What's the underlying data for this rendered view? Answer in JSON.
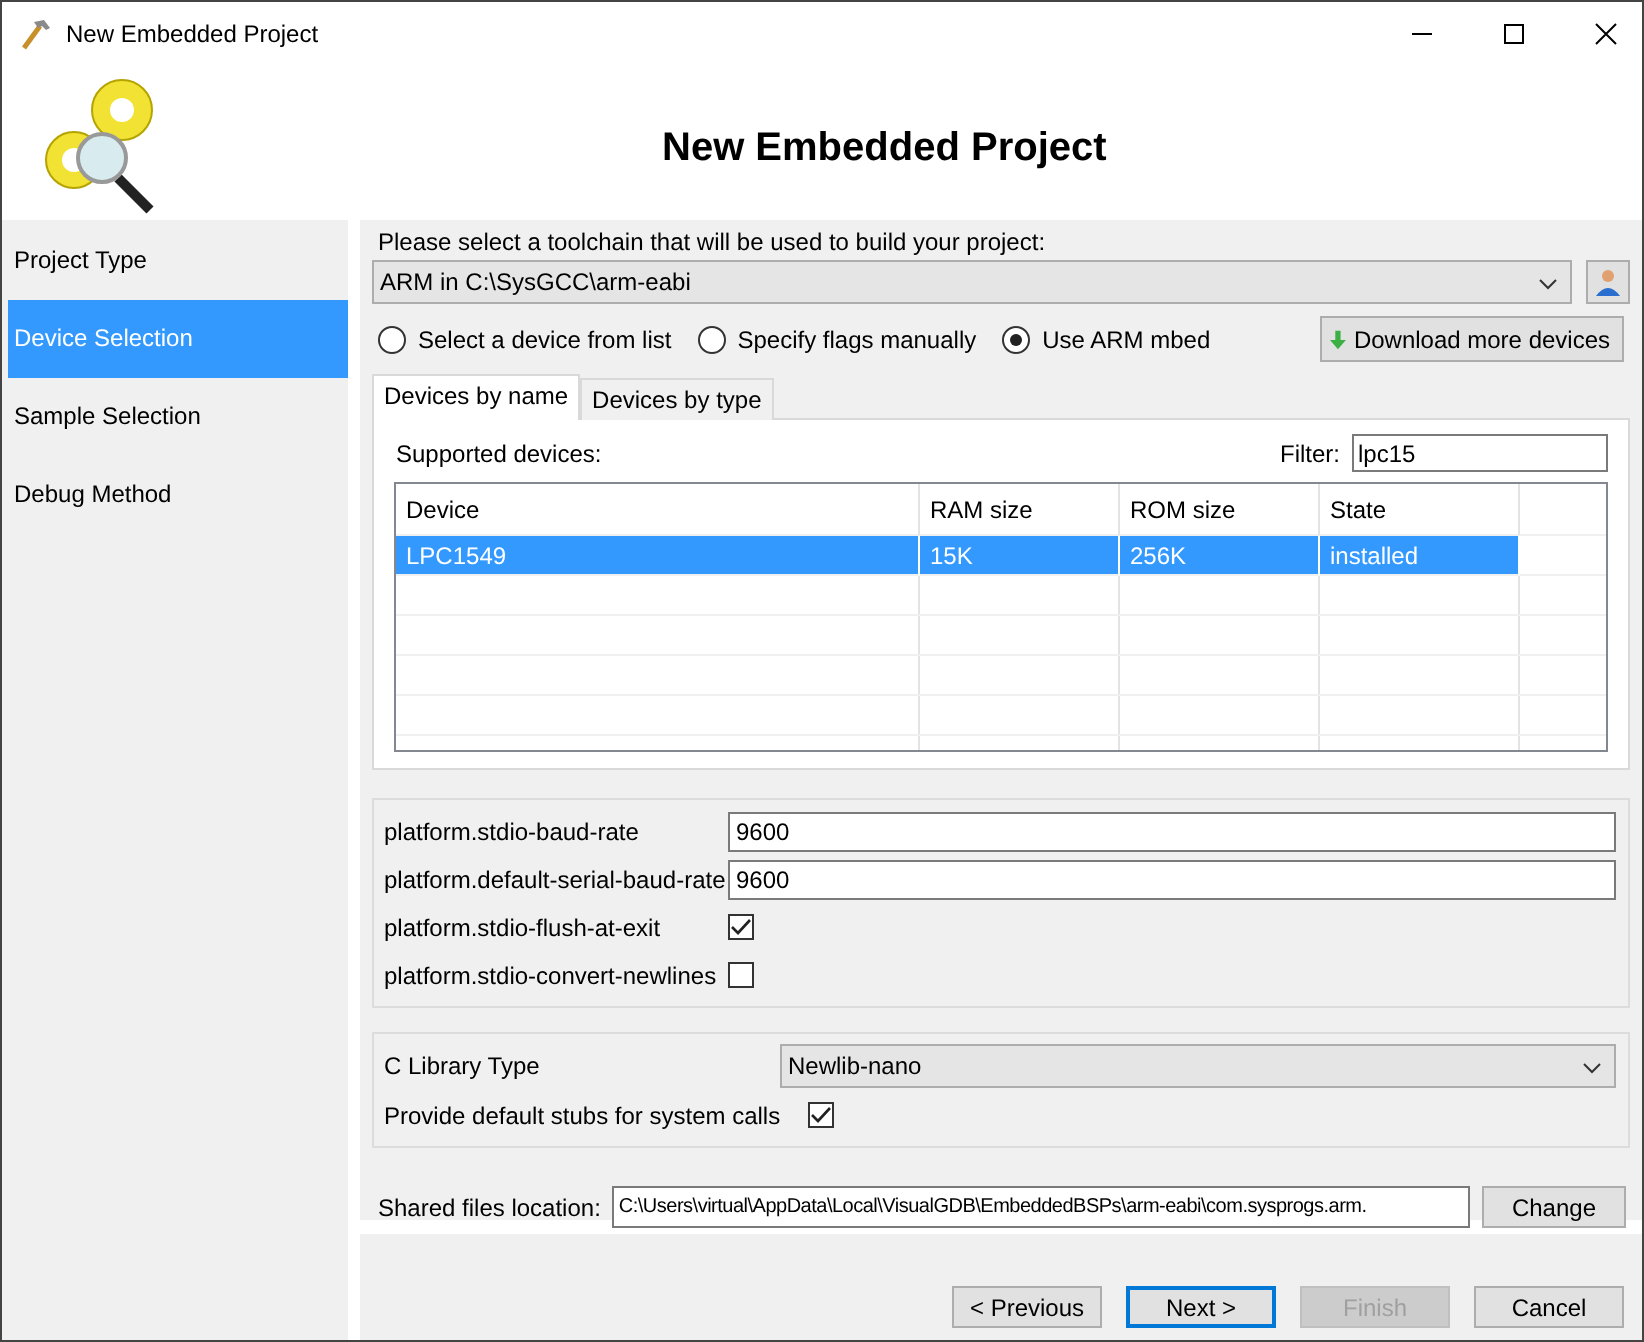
{
  "window": {
    "title": "New Embedded Project"
  },
  "header": {
    "title": "New Embedded Project"
  },
  "sidebar": {
    "items": [
      {
        "label": "Project Type",
        "selected": false
      },
      {
        "label": "Device Selection",
        "selected": true
      },
      {
        "label": "Sample Selection",
        "selected": false
      },
      {
        "label": "Debug Method",
        "selected": false
      }
    ]
  },
  "toolchain": {
    "prompt": "Please select a toolchain that will be used to build your project:",
    "value": "ARM in C:\\SysGCC\\arm-eabi"
  },
  "modes": [
    {
      "label": "Select a device from list",
      "selected": false
    },
    {
      "label": "Specify flags manually",
      "selected": false
    },
    {
      "label": "Use ARM mbed",
      "selected": true
    }
  ],
  "download_button": "Download more devices",
  "tabs": [
    {
      "label": "Devices by name",
      "selected": true
    },
    {
      "label": "Devices by type",
      "selected": false
    }
  ],
  "devices": {
    "label": "Supported devices:",
    "filter_label": "Filter:",
    "filter": "lpc15",
    "columns": [
      "Device",
      "RAM size",
      "ROM size",
      "State"
    ],
    "rows": [
      {
        "cells": [
          "LPC1549",
          "15K",
          "256K",
          "installed"
        ],
        "selected": true
      }
    ]
  },
  "settings": [
    {
      "kind": "text",
      "label": "platform.stdio-baud-rate",
      "value": "9600"
    },
    {
      "kind": "text",
      "label": "platform.default-serial-baud-rate",
      "value": "9600"
    },
    {
      "kind": "checkbox",
      "label": "platform.stdio-flush-at-exit",
      "checked": true
    },
    {
      "kind": "checkbox",
      "label": "platform.stdio-convert-newlines",
      "checked": false
    }
  ],
  "library": {
    "label": "C Library Type",
    "value": "Newlib-nano",
    "stubs_label": "Provide default stubs for system calls",
    "stubs_checked": true
  },
  "shared": {
    "label": "Shared files location:",
    "value": "C:\\Users\\virtual\\AppData\\Local\\VisualGDB\\EmbeddedBSPs\\arm-eabi\\com.sysprogs.arm.",
    "button": "Change"
  },
  "buttons": [
    {
      "label": "< Previous",
      "disabled": false,
      "default": false
    },
    {
      "label": "Next >",
      "disabled": false,
      "default": true
    },
    {
      "label": "Finish",
      "disabled": true,
      "default": false
    },
    {
      "label": "Cancel",
      "disabled": false,
      "default": false
    }
  ]
}
